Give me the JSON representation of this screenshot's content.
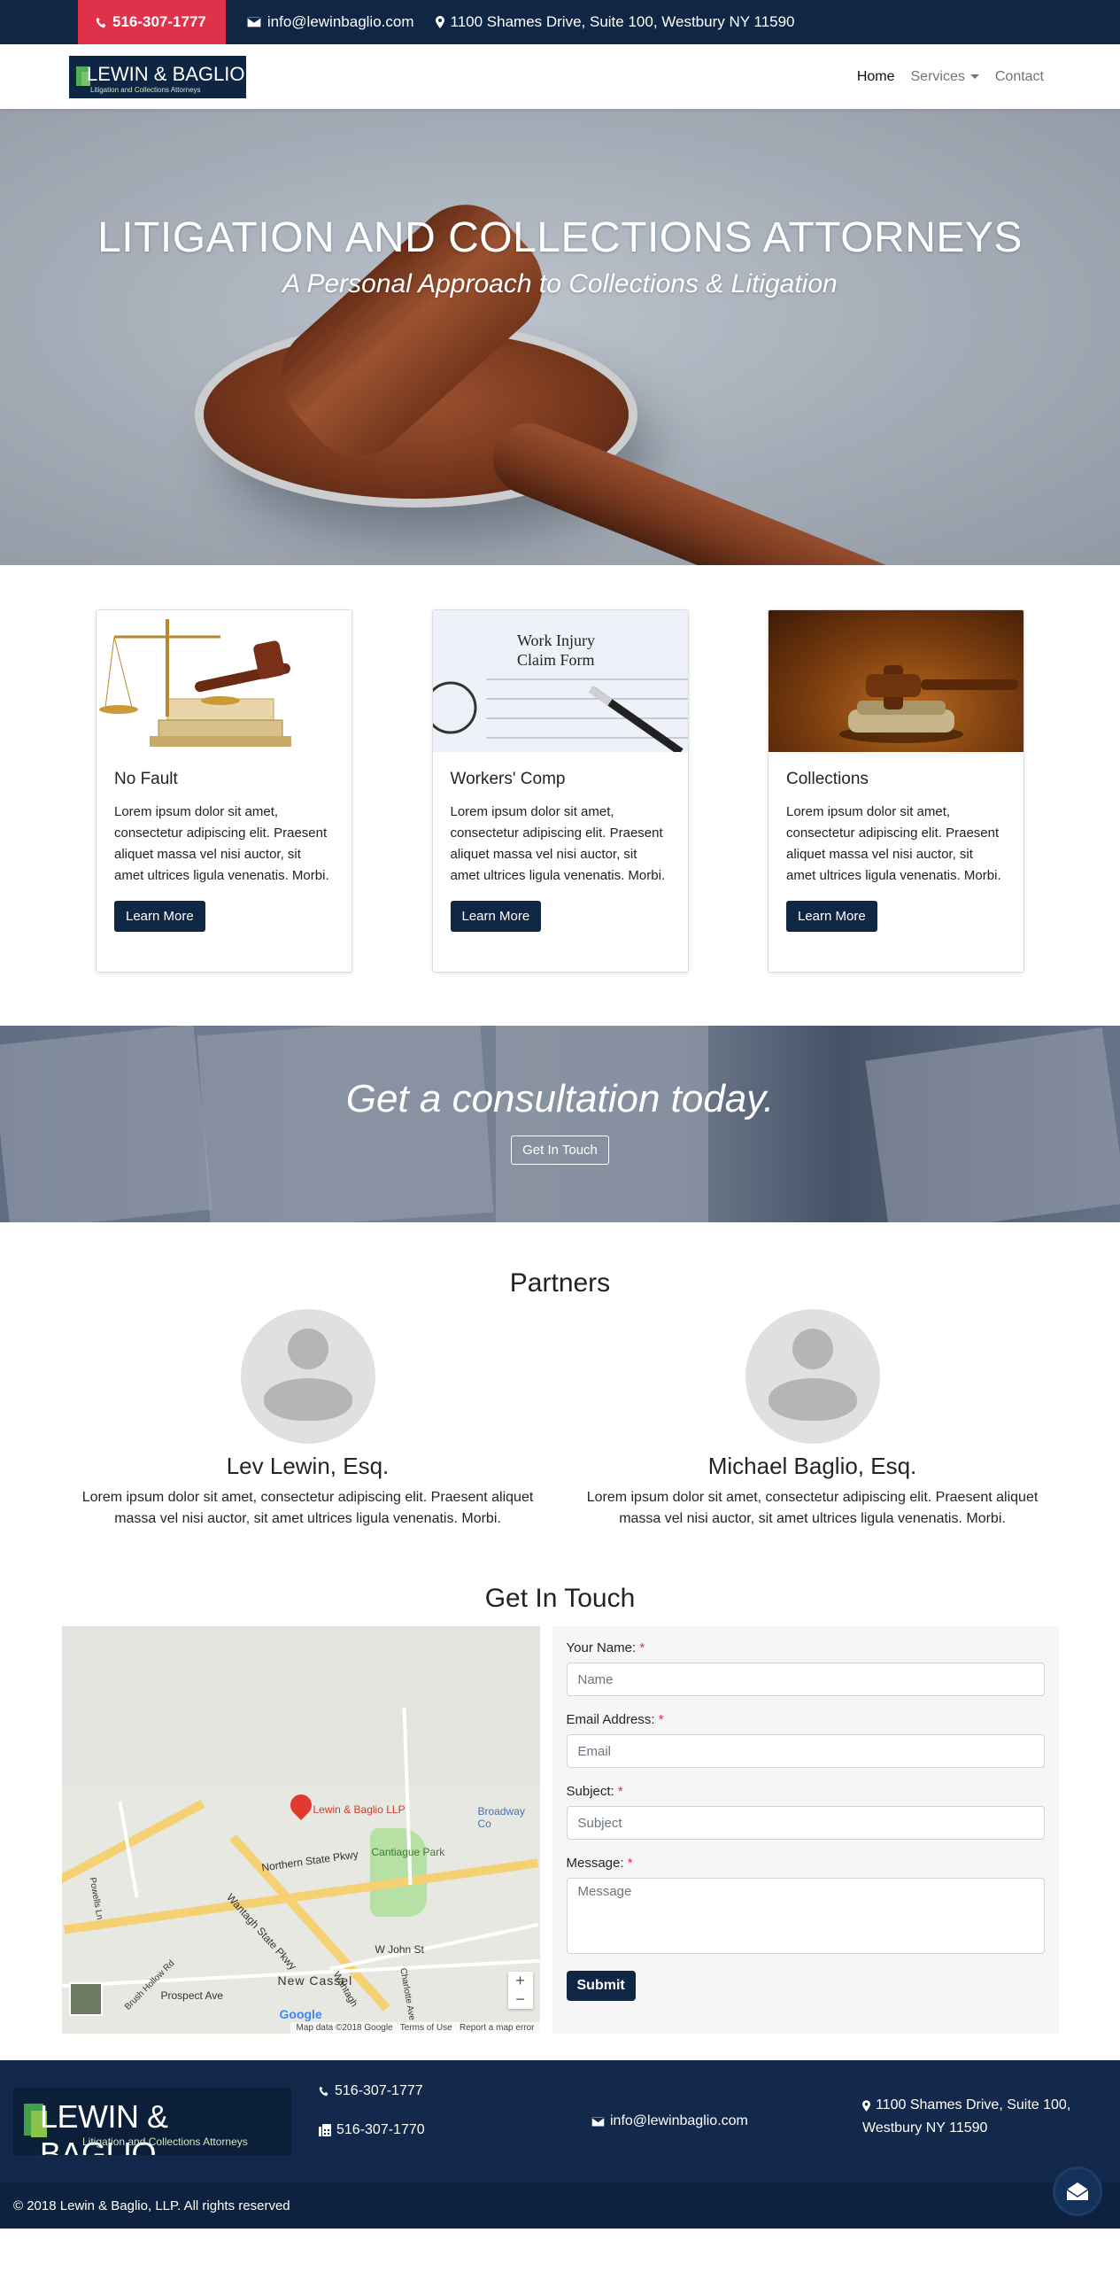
{
  "topbar": {
    "phone": "516-307-1777",
    "email": "info@lewinbaglio.com",
    "address": "1100 Shames Drive, Suite 100, Westbury NY 11590"
  },
  "logo": {
    "name": "LEWIN & BAGLIO",
    "tagline": "Litigation and Collections Attorneys"
  },
  "nav": {
    "home": "Home",
    "services": "Services",
    "contact": "Contact"
  },
  "hero": {
    "title": "LITIGATION AND COLLECTIONS ATTORNEYS",
    "subtitle": "A Personal Approach to Collections & Litigation"
  },
  "cards": [
    {
      "title": "No Fault",
      "text": "Lorem ipsum dolor sit amet, consectetur adipiscing elit. Praesent aliquet massa vel nisi auctor, sit amet ultrices ligula venenatis. Morbi.",
      "button": "Learn More"
    },
    {
      "title": "Workers' Comp",
      "text": "Lorem ipsum dolor sit amet, consectetur adipiscing elit. Praesent aliquet massa vel nisi auctor, sit amet ultrices ligula venenatis. Morbi.",
      "button": "Learn More",
      "image_text": "Work Injury Claim Form"
    },
    {
      "title": "Collections",
      "text": "Lorem ipsum dolor sit amet, consectetur adipiscing elit. Praesent aliquet massa vel nisi auctor, sit amet ultrices ligula venenatis. Morbi.",
      "button": "Learn More"
    }
  ],
  "cta": {
    "title": "Get a consultation today.",
    "button": "Get In Touch"
  },
  "partners": {
    "title": "Partners",
    "people": [
      {
        "name": "Lev Lewin, Esq.",
        "bio": "Lorem ipsum dolor sit amet, consectetur adipiscing elit. Praesent aliquet massa vel nisi auctor, sit amet ultrices ligula venenatis. Morbi."
      },
      {
        "name": "Michael Baglio, Esq.",
        "bio": "Lorem ipsum dolor sit amet, consectetur adipiscing elit. Praesent aliquet massa vel nisi auctor, sit amet ultrices ligula venenatis. Morbi."
      }
    ]
  },
  "contact": {
    "title": "Get In Touch",
    "map": {
      "pin_label": "Lewin & Baglio LLP",
      "labels": [
        "Northern State Pkwy",
        "Cantiague Park",
        "Broadway Co",
        "Wantagh State Pkwy",
        "New Cassel",
        "Prospect Ave",
        "W John St",
        "Brush Hollow Rd",
        "Powells Ln",
        "Charlotte Ave",
        "Wantagh"
      ],
      "attribution": "Map data ©2018 Google",
      "terms": "Terms of Use",
      "report": "Report a map error",
      "google": "Google"
    },
    "form": {
      "name_label": "Your Name:",
      "name_placeholder": "Name",
      "email_label": "Email Address:",
      "email_placeholder": "Email",
      "subject_label": "Subject:",
      "subject_placeholder": "Subject",
      "message_label": "Message:",
      "message_placeholder": "Message",
      "required_mark": "*",
      "submit": "Submit"
    }
  },
  "footer": {
    "phone": "516-307-1777",
    "fax": "516-307-1770",
    "email": "info@lewinbaglio.com",
    "address_line1": "1100 Shames Drive, Suite 100,",
    "address_line2": "Westbury NY 11590",
    "copyright": "© 2018 Lewin & Baglio, LLP. All rights reserved"
  },
  "colors": {
    "navy": "#0f2745",
    "accent_red": "#e0314a",
    "logo_green": "#4caf50"
  }
}
